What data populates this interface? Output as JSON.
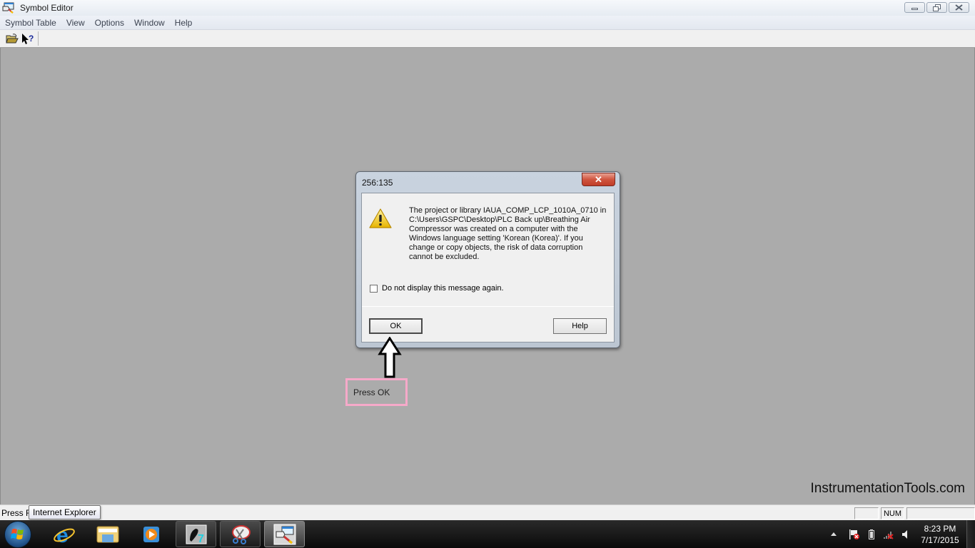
{
  "window": {
    "title": "Symbol Editor",
    "app_icon": "symbol-editor-icon",
    "controls": {
      "minimize": "minimize-icon",
      "restore": "restore-icon",
      "close": "close-icon"
    }
  },
  "menubar": {
    "items": [
      {
        "label": "Symbol Table"
      },
      {
        "label": "View"
      },
      {
        "label": "Options"
      },
      {
        "label": "Window"
      },
      {
        "label": "Help"
      }
    ]
  },
  "toolbar": {
    "buttons": [
      {
        "icon": "open-folder-icon",
        "tooltip": ""
      },
      {
        "icon": "context-help-icon",
        "tooltip": ""
      }
    ]
  },
  "dialog": {
    "title": "256:135",
    "close_glyph": "✕",
    "icon": "warning-icon",
    "message_lines": [
      "The project or library IAUA_COMP_LCP_1010A_0710 in",
      "C:\\Users\\GSPC\\Desktop\\PLC Back up\\Breathing Air",
      "Compressor was created on a computer with the",
      "Windows language setting 'Korean (Korea)'. If you",
      "change or copy objects, the risk of data corruption",
      "cannot be excluded."
    ],
    "checkbox": {
      "label": "Do not display this message again.",
      "checked": false
    },
    "buttons": {
      "ok": "OK",
      "help": "Help"
    }
  },
  "annotation": {
    "label": "Press OK",
    "border_color": "#f6a9c9"
  },
  "watermark": "InstrumentationTools.com",
  "statusbar": {
    "text": "Press F1",
    "tooltip": "Internet Explorer",
    "panes": [
      "",
      "NUM",
      ""
    ]
  },
  "taskbar": {
    "start": "windows-start-icon",
    "apps": [
      {
        "name": "internet-explorer",
        "state": "pinned"
      },
      {
        "name": "windows-explorer",
        "state": "pinned"
      },
      {
        "name": "windows-media-player",
        "state": "pinned"
      },
      {
        "name": "simatic-manager",
        "state": "open"
      },
      {
        "name": "snipping-tool",
        "state": "open"
      },
      {
        "name": "symbol-editor",
        "state": "active"
      }
    ],
    "tray": {
      "icons": [
        "show-hidden-icons",
        "action-center-icon",
        "battery-icon",
        "network-disconnected-icon",
        "volume-icon"
      ],
      "time": "8:23 PM",
      "date": "7/17/2015"
    }
  }
}
